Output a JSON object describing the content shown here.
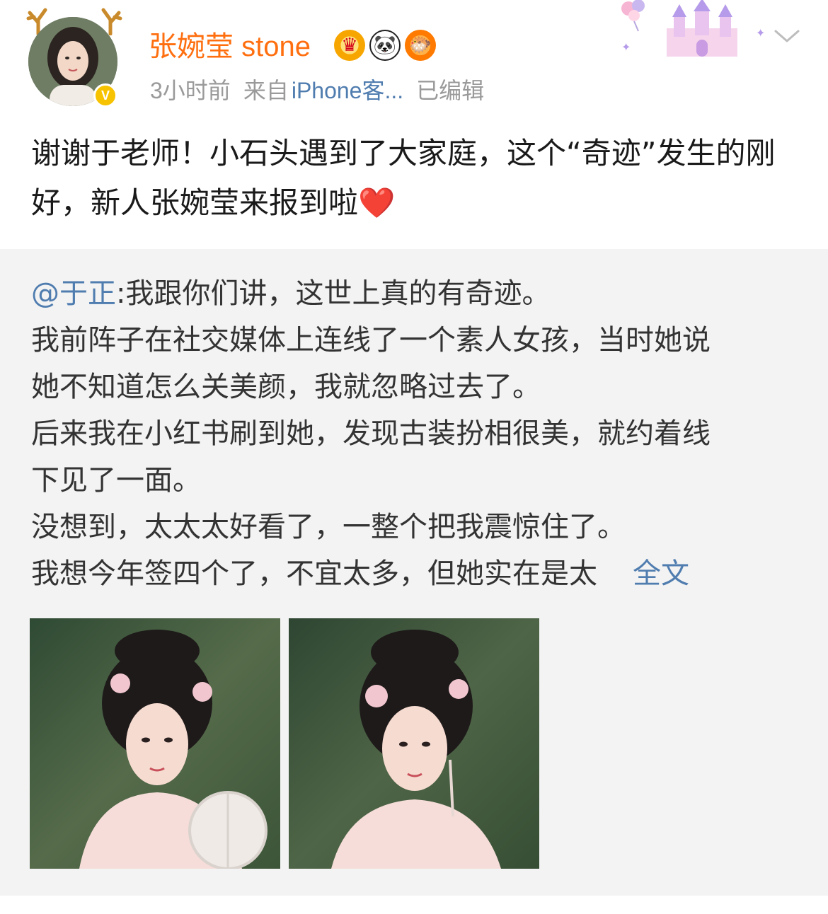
{
  "post": {
    "author": {
      "name": "张婉莹 stone",
      "verified_mark": "V",
      "badges": [
        {
          "icon": "crown-badge-icon",
          "glyph": "♛"
        },
        {
          "icon": "panda-badge-icon",
          "glyph": "🐼"
        },
        {
          "icon": "fish-badge-icon",
          "glyph": "🐡"
        }
      ]
    },
    "meta": {
      "time": "3小时前",
      "source_prefix": "来自",
      "source": "iPhone客...",
      "edited": "已编辑"
    },
    "text": "谢谢于老师！小石头遇到了大家庭，这个“奇迹”发生的刚好，新人张婉莹来报到啦",
    "emoji": "❤️"
  },
  "repost": {
    "mention": "@于正",
    "lines": [
      ":我跟你们讲，这世上真的有奇迹。",
      "我前阵子在社交媒体上连线了一个素人女孩，当时她说",
      "她不知道怎么关美颜，我就忽略过去了。",
      "后来我在小红书刷到她，发现古装扮相很美，就约着线",
      "下见了一面。",
      "没想到，太太太好看了，一整个把我震惊住了。",
      "我想今年签四个了，不宜太多，但她实在是太"
    ],
    "more_label": "全文"
  },
  "colors": {
    "username": "#ff6f10",
    "link": "#507daf",
    "meta": "#9a9a9a",
    "repost_bg": "#f3f3f3",
    "verified": "#f7c200"
  }
}
